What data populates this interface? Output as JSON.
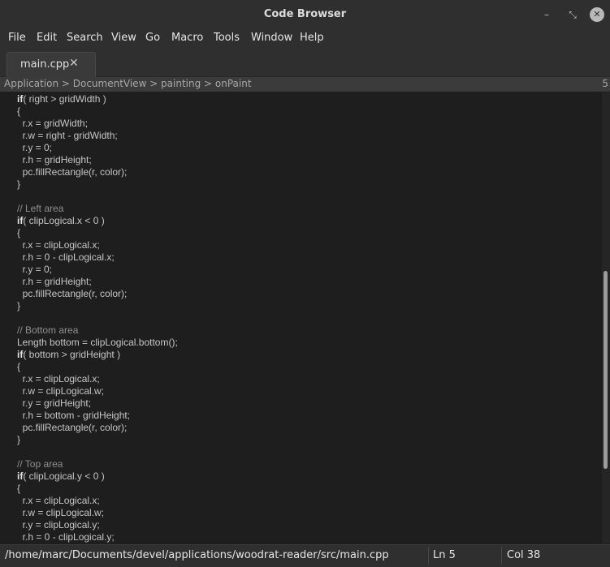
{
  "window": {
    "title": "Code Browser",
    "min_glyph": "–",
    "max_glyph": "⤡",
    "close_glyph": "✕"
  },
  "menu": [
    "File",
    "Edit",
    "Search",
    "View",
    "Go",
    "Macro",
    "Tools",
    "Window",
    "Help"
  ],
  "tab": {
    "label": "main.cpp",
    "close_glyph": "✕"
  },
  "breadcrumb": {
    "path": "Application > DocumentView > painting > onPaint",
    "right": "5"
  },
  "code_lines": [
    [
      {
        "t": "if",
        "c": "kw"
      },
      {
        "t": "( right > gridWidth )"
      }
    ],
    [
      {
        "t": "{"
      }
    ],
    [
      {
        "t": "  r.x = gridWidth;"
      }
    ],
    [
      {
        "t": "  r.w = right - gridWidth;"
      }
    ],
    [
      {
        "t": "  r.y = 0;"
      }
    ],
    [
      {
        "t": "  r.h = gridHeight;"
      }
    ],
    [
      {
        "t": "  pc.fillRectangle(r, color);"
      }
    ],
    [
      {
        "t": "}"
      }
    ],
    [],
    [
      {
        "t": "// Left area",
        "c": "cm"
      }
    ],
    [
      {
        "t": "if",
        "c": "kw"
      },
      {
        "t": "( clipLogical.x < 0 )"
      }
    ],
    [
      {
        "t": "{"
      }
    ],
    [
      {
        "t": "  r.x = clipLogical.x;"
      }
    ],
    [
      {
        "t": "  r.h = 0 - clipLogical.x;"
      }
    ],
    [
      {
        "t": "  r.y = 0;"
      }
    ],
    [
      {
        "t": "  r.h = gridHeight;"
      }
    ],
    [
      {
        "t": "  pc.fillRectangle(r, color);"
      }
    ],
    [
      {
        "t": "}"
      }
    ],
    [],
    [
      {
        "t": "// Bottom area",
        "c": "cm"
      }
    ],
    [
      {
        "t": "Length bottom = clipLogical.bottom();"
      }
    ],
    [
      {
        "t": "if",
        "c": "kw"
      },
      {
        "t": "( bottom > gridHeight )"
      }
    ],
    [
      {
        "t": "{"
      }
    ],
    [
      {
        "t": "  r.x = clipLogical.x;"
      }
    ],
    [
      {
        "t": "  r.w = clipLogical.w;"
      }
    ],
    [
      {
        "t": "  r.y = gridHeight;"
      }
    ],
    [
      {
        "t": "  r.h = bottom - gridHeight;"
      }
    ],
    [
      {
        "t": "  pc.fillRectangle(r, color);"
      }
    ],
    [
      {
        "t": "}"
      }
    ],
    [],
    [
      {
        "t": "// Top area",
        "c": "cm"
      }
    ],
    [
      {
        "t": "if",
        "c": "kw"
      },
      {
        "t": "( clipLogical.y < 0 )"
      }
    ],
    [
      {
        "t": "{"
      }
    ],
    [
      {
        "t": "  r.x = clipLogical.x;"
      }
    ],
    [
      {
        "t": "  r.w = clipLogical.w;"
      }
    ],
    [
      {
        "t": "  r.y = clipLogical.y;"
      }
    ],
    [
      {
        "t": "  r.h = 0 - clipLogical.y;"
      }
    ]
  ],
  "status": {
    "path": "/home/marc/Documents/devel/applications/woodrat-reader/src/main.cpp",
    "line": "Ln 5",
    "col": "Col 38"
  }
}
